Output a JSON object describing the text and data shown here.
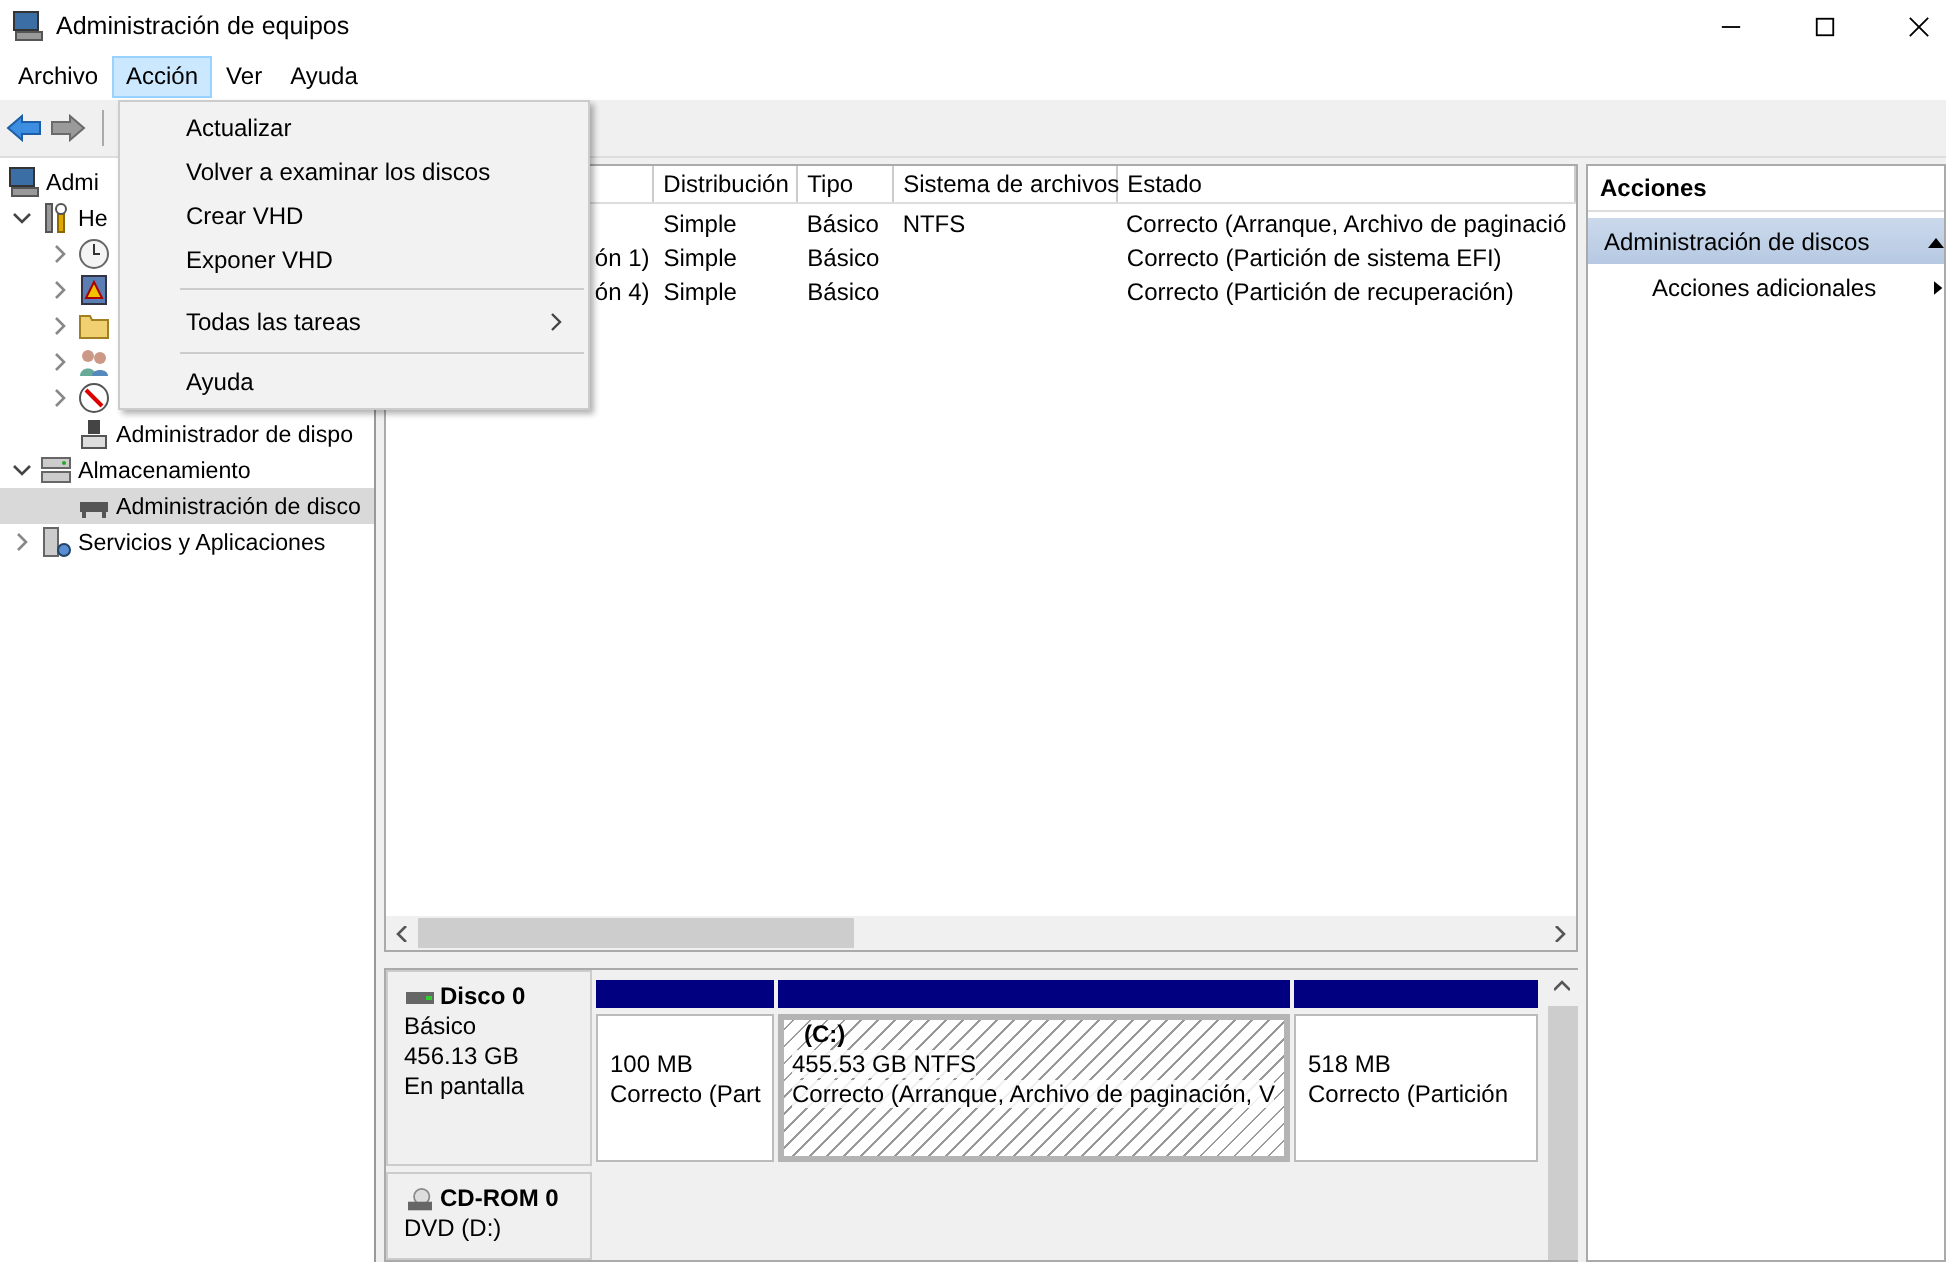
{
  "window": {
    "title": "Administración de equipos"
  },
  "menu": [
    {
      "label": "Archivo",
      "selected": false
    },
    {
      "label": "Acción",
      "selected": true
    },
    {
      "label": "Ver",
      "selected": false
    },
    {
      "label": "Ayuda",
      "selected": false
    }
  ],
  "dropdown": [
    {
      "kind": "item",
      "label": "Actualizar"
    },
    {
      "kind": "item",
      "label": "Volver a examinar los discos"
    },
    {
      "kind": "item",
      "label": "Crear VHD"
    },
    {
      "kind": "item",
      "label": "Exponer VHD"
    },
    {
      "kind": "separator"
    },
    {
      "kind": "submenu",
      "label": "Todas las tareas"
    },
    {
      "kind": "separator"
    },
    {
      "kind": "item",
      "label": "Ayuda"
    }
  ],
  "tree": [
    {
      "kind": "computer",
      "label": "Admi",
      "selected": false,
      "children": [
        {
          "kind": "tools",
          "label": "He",
          "expanded": true,
          "selected": false,
          "children": [
            {
              "kind": "clock",
              "expanded": false,
              "selected": false
            },
            {
              "kind": "event-log",
              "expanded": false,
              "selected": false
            },
            {
              "kind": "shared-folder",
              "expanded": false,
              "selected": false
            },
            {
              "kind": "users",
              "expanded": false,
              "selected": false
            },
            {
              "kind": "performance",
              "expanded": false,
              "selected": false
            },
            {
              "kind": "device",
              "label": "Administrador de dispo",
              "selected": false
            }
          ]
        },
        {
          "kind": "storage",
          "label": "Almacenamiento",
          "expanded": true,
          "selected": false,
          "children": [
            {
              "kind": "disk",
              "label": "Administración de disco",
              "selected": true
            }
          ]
        },
        {
          "kind": "services",
          "label": "Servicios y Aplicaciones",
          "expanded": false,
          "selected": false
        }
      ]
    }
  ],
  "table": {
    "columns": [
      "Distribución",
      "Tipo",
      "Sistema de archivos",
      "Estado"
    ],
    "rows": [
      {
        "distribucion": "Simple",
        "tipo": "Básico",
        "sistema_de_archivos": "NTFS",
        "estado": "Correcto (Arranque, Archivo de paginació"
      },
      {
        "column_1": "ón 1)",
        "distribucion": "Simple",
        "tipo": "Básico",
        "estado": "Correcto (Partición de sistema EFI)"
      },
      {
        "column_1": "ón 4)",
        "distribucion": "Simple",
        "tipo": "Básico",
        "estado": "Correcto (Partición de recuperación)"
      }
    ]
  },
  "disks": [
    {
      "kind": "disk",
      "name": "Disco 0",
      "lines": [
        "Básico",
        "456.13 GB",
        "En pantalla"
      ],
      "partitions": [
        {
          "size": "100 MB",
          "status": "Correcto (Part",
          "selected": false
        },
        {
          "name": "(C:)",
          "size": "455.53 GB NTFS",
          "status": "Correcto (Arranque, Archivo de paginación, V",
          "selected": true
        },
        {
          "size": "518 MB",
          "status": "Correcto (Partición",
          "selected": false
        }
      ]
    },
    {
      "kind": "cdrom",
      "name": "CD-ROM 0",
      "lines": [
        "DVD (D:)"
      ]
    }
  ],
  "actions": {
    "title": "Acciones",
    "section": "Administración de discos",
    "items": [
      "Acciones adicionales"
    ]
  }
}
